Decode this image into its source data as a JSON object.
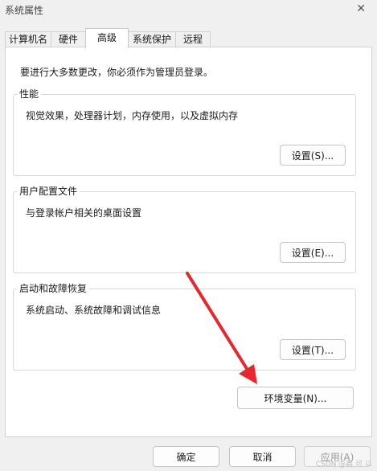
{
  "window": {
    "title": "系统属性",
    "close_glyph": "✕"
  },
  "tabs": [
    {
      "label": "计算机名"
    },
    {
      "label": "硬件"
    },
    {
      "label": "高级",
      "active": true
    },
    {
      "label": "系统保护"
    },
    {
      "label": "远程"
    }
  ],
  "panel": {
    "notice": "要进行大多数更改，你必须作为管理员登录。",
    "performance": {
      "legend": "性能",
      "desc": "视觉效果，处理器计划，内存使用，以及虚拟内存",
      "button": "设置(S)..."
    },
    "profile": {
      "legend": "用户配置文件",
      "desc": "与登录帐户相关的桌面设置",
      "button": "设置(E)..."
    },
    "startup": {
      "legend": "启动和故障恢复",
      "desc": "系统启动、系统故障和调试信息",
      "button": "设置(T)..."
    },
    "env_button": "环境变量(N)..."
  },
  "footer": {
    "ok": "确定",
    "cancel": "取消",
    "apply": "应用(A)"
  },
  "watermark": "CSDN @鑫 可 以",
  "colors": {
    "arrow": "#e8262b"
  }
}
